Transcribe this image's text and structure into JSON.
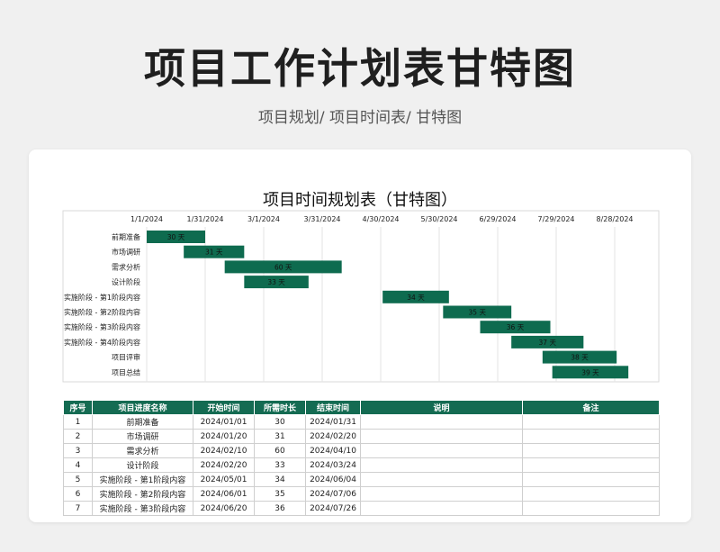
{
  "header": {
    "title": "项目工作计划表甘特图",
    "breadcrumb": "项目规划/  项目时间表/  甘特图"
  },
  "colors": {
    "accent": "#146b52",
    "bar": "#0e6b4f"
  },
  "chart_data": {
    "type": "bar",
    "title": "项目时间规划表（甘特图）",
    "x_ticks": [
      "1/1/2024",
      "1/31/2024",
      "3/1/2024",
      "3/31/2024",
      "4/30/2024",
      "5/30/2024",
      "6/29/2024",
      "7/29/2024",
      "8/28/2024"
    ],
    "xlim": [
      "2024-01-01",
      "2024-08-28"
    ],
    "categories": [
      "前期准备",
      "市场调研",
      "需求分析",
      "设计阶段",
      "实施阶段 - 第1阶段内容",
      "实施阶段 - 第2阶段内容",
      "实施阶段 - 第3阶段内容",
      "实施阶段 - 第4阶段内容",
      "项目评审",
      "项目总结"
    ],
    "start": [
      "2024-01-01",
      "2024-01-20",
      "2024-02-10",
      "2024-02-20",
      "2024-05-01",
      "2024-06-01",
      "2024-06-20",
      "2024-07-06",
      "2024-07-22",
      "2024-07-27"
    ],
    "values": [
      30,
      31,
      60,
      33,
      34,
      35,
      36,
      37,
      38,
      39
    ],
    "labels": [
      "30 天",
      "31 天",
      "60 天",
      "33 天",
      "34 天",
      "35 天",
      "36 天",
      "37 天",
      "38 天",
      "39 天"
    ],
    "grid": true
  },
  "table": {
    "headers": [
      "序号",
      "项目进度名称",
      "开始时间",
      "所需时长",
      "结束时间",
      "说明",
      "备注"
    ],
    "rows": [
      [
        "1",
        "前期准备",
        "2024/01/01",
        "30",
        "2024/01/31",
        "",
        ""
      ],
      [
        "2",
        "市场调研",
        "2024/01/20",
        "31",
        "2024/02/20",
        "",
        ""
      ],
      [
        "3",
        "需求分析",
        "2024/02/10",
        "60",
        "2024/04/10",
        "",
        ""
      ],
      [
        "4",
        "设计阶段",
        "2024/02/20",
        "33",
        "2024/03/24",
        "",
        ""
      ],
      [
        "5",
        "实施阶段 - 第1阶段内容",
        "2024/05/01",
        "34",
        "2024/06/04",
        "",
        ""
      ],
      [
        "6",
        "实施阶段 - 第2阶段内容",
        "2024/06/01",
        "35",
        "2024/07/06",
        "",
        ""
      ],
      [
        "7",
        "实施阶段 - 第3阶段内容",
        "2024/06/20",
        "36",
        "2024/07/26",
        "",
        ""
      ]
    ]
  }
}
